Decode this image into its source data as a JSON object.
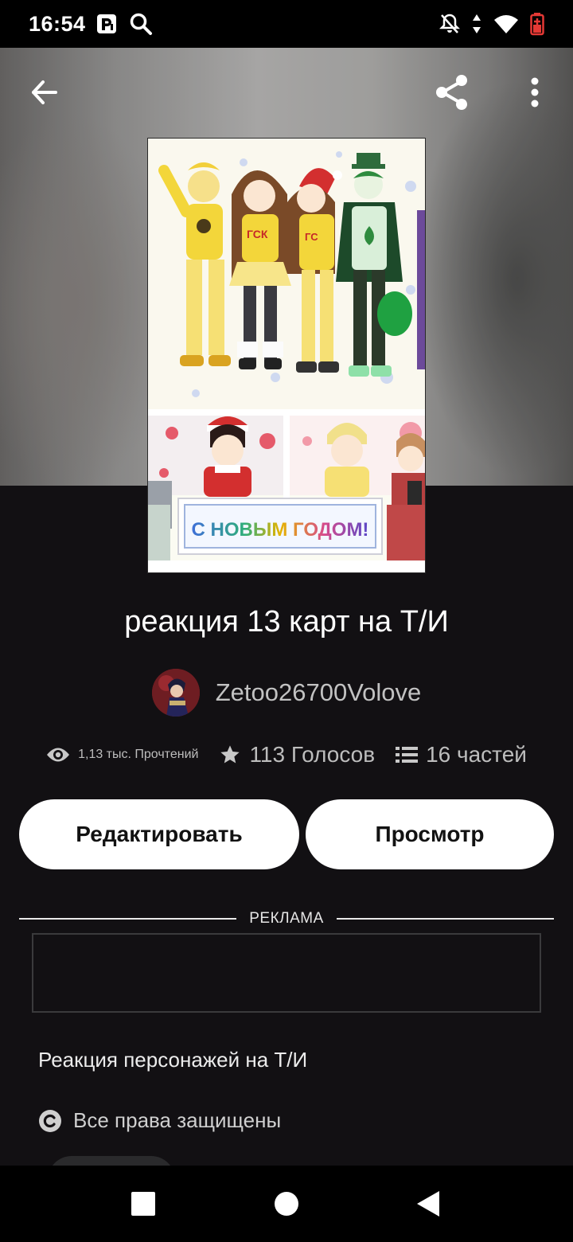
{
  "status_bar": {
    "time": "16:54",
    "left_icons": [
      "parking-icon",
      "search-icon"
    ],
    "right_icons": [
      "notifications-off-icon",
      "data-arrows-icon",
      "wifi-icon",
      "battery-icon"
    ]
  },
  "toolbar": {
    "back_icon": "arrow-left-icon",
    "share_icon": "share-icon",
    "more_icon": "more-vertical-icon"
  },
  "cover": {
    "banner_text": "С НОВЫМ ГОДОМ!",
    "shirt_text": "ГСК"
  },
  "story": {
    "title": "реакция 13 карт на Т/И",
    "author": "Zetoo26700Volove"
  },
  "stats": {
    "reads": "1,13 тыс. Прочтений",
    "votes": "113 Голосов",
    "parts": "16 частей"
  },
  "actions": {
    "edit_label": "Редактировать",
    "view_label": "Просмотр"
  },
  "ad": {
    "label": "РЕКЛАМА"
  },
  "description": "Реакция персонажей на Т/И",
  "license": "Все права защищены",
  "colors": {
    "background": "#121013",
    "button_bg": "#ffffff",
    "button_text": "#121212",
    "muted_text": "#bdbdbd"
  },
  "nav_bar": {
    "recents_icon": "square-icon",
    "home_icon": "circle-icon",
    "back_icon": "triangle-back-icon"
  }
}
